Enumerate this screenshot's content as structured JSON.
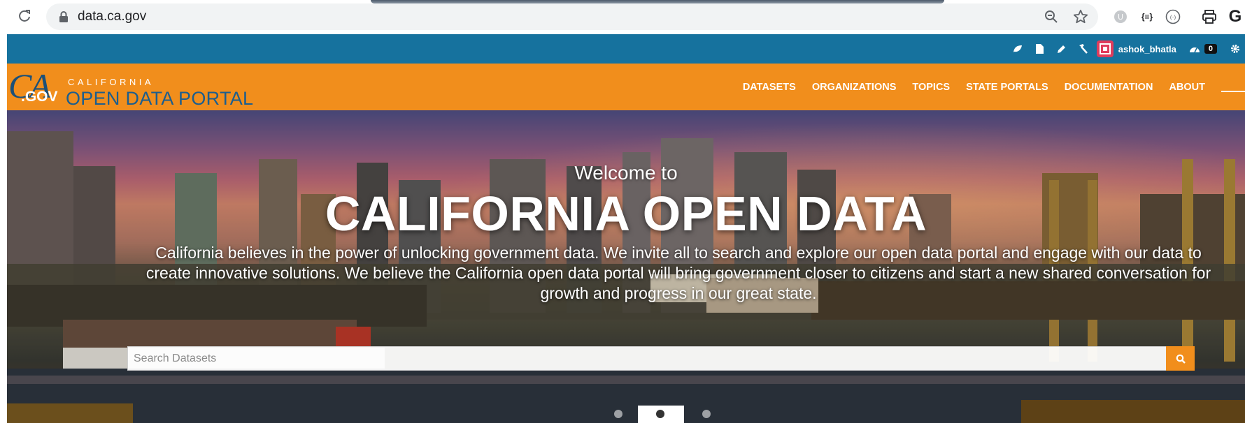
{
  "browser": {
    "url": "data.ca.gov",
    "icons": [
      "reload-icon",
      "lock-icon",
      "zoom-icon",
      "bookmark-star-icon",
      "extension-icon",
      "json-viewer-icon",
      "code-icon",
      "print-icon",
      "google-icon"
    ],
    "json_ext_label": "{≡}",
    "google_label": "G"
  },
  "admin_bar": {
    "username": "ashok_bhatla",
    "notification_count": "0",
    "icons": [
      "leaf-icon",
      "page-icon",
      "pencil-icon",
      "hammer-icon",
      "avatar",
      "dashboard-icon",
      "gear-icon"
    ]
  },
  "header": {
    "logo": {
      "ca": "CA",
      "gov": ".GOV",
      "state": "CALIFORNIA",
      "portal": "OPEN DATA PORTAL"
    },
    "nav": [
      "DATASETS",
      "ORGANIZATIONS",
      "TOPICS",
      "STATE PORTALS",
      "DOCUMENTATION",
      "ABOUT"
    ]
  },
  "hero": {
    "welcome": "Welcome to",
    "title": "CALIFORNIA OPEN DATA",
    "description": "California believes in the power of unlocking government data. We invite all to search and explore our open data portal and engage with our data to create innovative solutions. We believe the California open data portal will bring government closer to citizens and start a new shared conversation for growth and progress in our great state.",
    "search_placeholder": "Search Datasets",
    "carousel": {
      "slides": 3,
      "active": 2
    }
  },
  "colors": {
    "admin_bar": "#16729e",
    "header": "#f18e1c",
    "logo_blue": "#1c5e8e",
    "search_button": "#f18e1c"
  }
}
